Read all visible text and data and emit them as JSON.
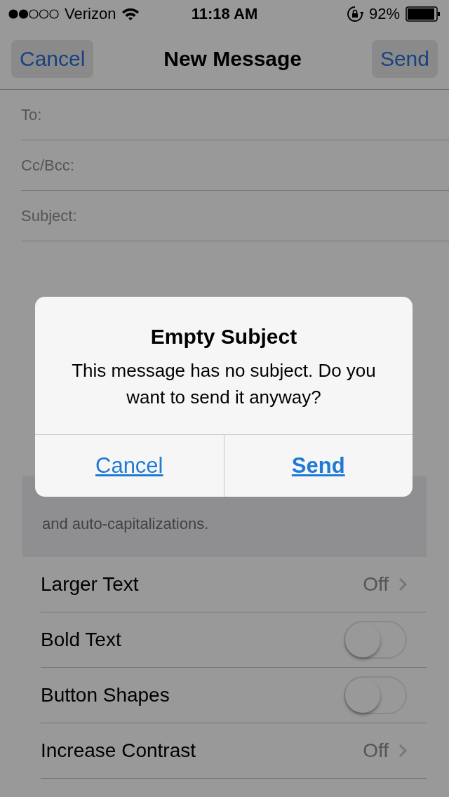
{
  "status_bar": {
    "carrier": "Verizon",
    "time": "11:18 AM",
    "battery": "92%"
  },
  "nav": {
    "cancel": "Cancel",
    "title": "New Message",
    "send": "Send"
  },
  "fields": [
    {
      "label": "To:"
    },
    {
      "label": "Cc/Bcc:"
    },
    {
      "label": "Subject:"
    }
  ],
  "screenshot": {
    "footer": "and auto-capitalizations.",
    "rows": [
      {
        "kind": "disclosure",
        "label": "Larger Text",
        "value": "Off"
      },
      {
        "kind": "toggle",
        "label": "Bold Text",
        "on": false
      },
      {
        "kind": "toggle",
        "label": "Button Shapes",
        "on": false
      },
      {
        "kind": "disclosure",
        "label": "Increase Contrast",
        "value": "Off"
      }
    ]
  },
  "alert": {
    "title": "Empty Subject",
    "message": "This message has no subject. Do you want to send it anyway?",
    "buttons": [
      {
        "kind": "cancel",
        "label": "Cancel"
      },
      {
        "kind": "default",
        "label": "Send"
      }
    ]
  }
}
